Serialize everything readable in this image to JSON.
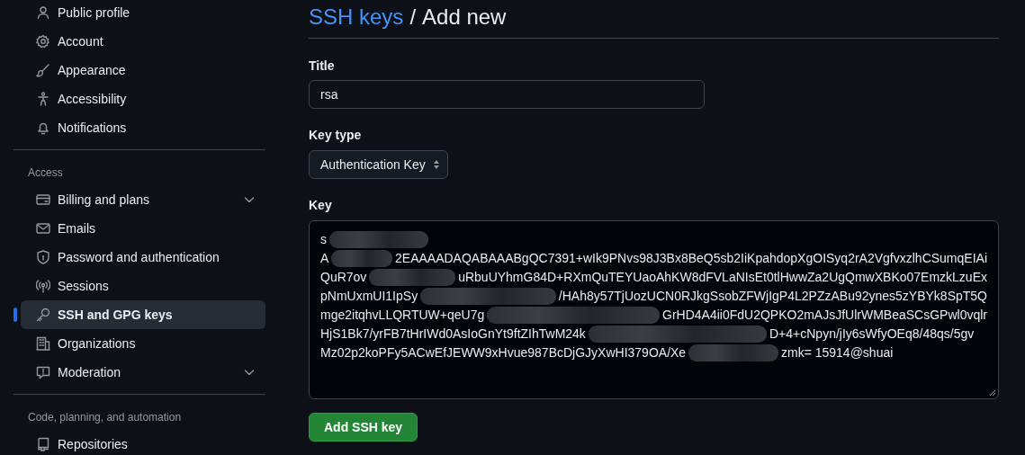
{
  "sidebar": {
    "groups": [
      {
        "items": [
          {
            "label": "Public profile",
            "selected": false,
            "collapsible": false
          },
          {
            "label": "Account",
            "selected": false,
            "collapsible": false
          },
          {
            "label": "Appearance",
            "selected": false,
            "collapsible": false
          },
          {
            "label": "Accessibility",
            "selected": false,
            "collapsible": false
          },
          {
            "label": "Notifications",
            "selected": false,
            "collapsible": false
          }
        ]
      },
      {
        "heading": "Access",
        "items": [
          {
            "label": "Billing and plans",
            "selected": false,
            "collapsible": true
          },
          {
            "label": "Emails",
            "selected": false,
            "collapsible": false
          },
          {
            "label": "Password and authentication",
            "selected": false,
            "collapsible": false
          },
          {
            "label": "Sessions",
            "selected": false,
            "collapsible": false
          },
          {
            "label": "SSH and GPG keys",
            "selected": true,
            "collapsible": false
          },
          {
            "label": "Organizations",
            "selected": false,
            "collapsible": false
          },
          {
            "label": "Moderation",
            "selected": false,
            "collapsible": true
          }
        ]
      },
      {
        "heading": "Code, planning, and automation",
        "items": [
          {
            "label": "Repositories",
            "selected": false,
            "collapsible": false
          }
        ]
      }
    ]
  },
  "page": {
    "breadcrumb_link": "SSH keys",
    "separator": "/",
    "title": "Add new"
  },
  "form": {
    "title_label": "Title",
    "title_value": "rsa",
    "key_type_label": "Key type",
    "key_type_value": "Authentication Key",
    "key_label": "Key",
    "key_lines": [
      {
        "visible_start": "s"
      },
      {
        "visible_start": "A",
        "visible_end": "2EAAAADAQABAAABgQC7391+wIk9PNvs98J3Bx8BeQ5sb2IiKpahdopXgOISyq2rA2VgfvxzlhCSumqEIAi"
      },
      {
        "visible_start": "QuR7ov",
        "visible_end": "uRbuUYhmG84D+RXmQuTEYUaoAhKW8dFVLaNIsEt0tlHwwZa2UgQmwXBKo07EmzkLzuEx"
      },
      {
        "visible_start": "pNmUxmUI1IpSy",
        "visible_end": "/HAh8y57TjUozUCN0RJkgSsobZFWjIgP4L2PZzABu92ynes5zYBYk8SpT5Q"
      },
      {
        "visible_start": "mge2itqhvLLQRTUW+qeU7g",
        "visible_end": "GrHD4A4ii0FdU2QPKO2mAJsJfUlrWMBeaSCsGPwl0vqlr"
      },
      {
        "visible_start": "HjS1Bk7/yrFB7tHrIWd0AsIoGnYt9ftZIhTwM24k",
        "visible_end": "D+4+cNpyn/jIy6sWfyOEq8/48qs/5gv"
      },
      {
        "visible_start": "Mz02p2koPFy5ACwEfJEWW9xHvue987BcDjGJyXwHI379OA/Xe",
        "visible_end": "zmk= 15914@shuai"
      }
    ],
    "submit": "Add SSH key"
  }
}
